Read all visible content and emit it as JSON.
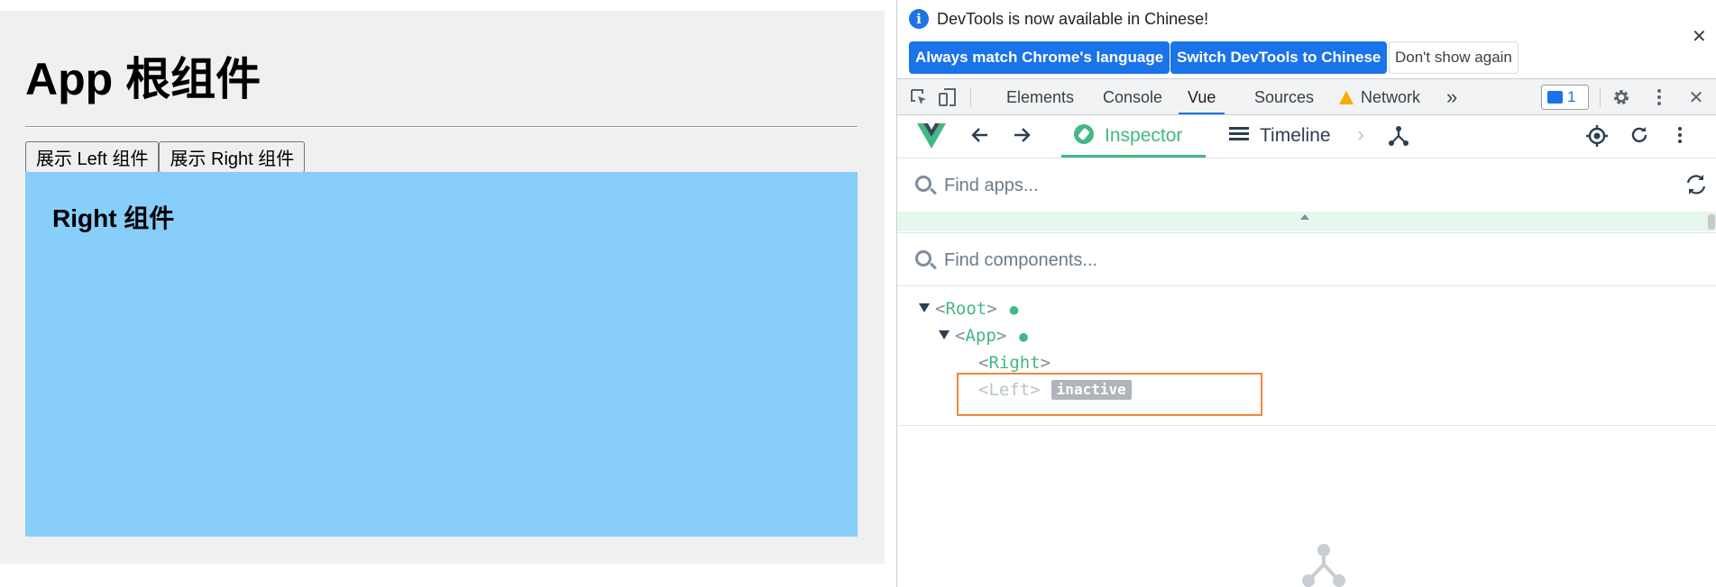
{
  "page": {
    "title": "App 根组件",
    "buttons": {
      "show_left": "展示 Left 组件",
      "show_right": "展示 Right 组件"
    },
    "right_component_title": "Right 组件",
    "colors": {
      "page_bg": "#f0f0f0",
      "right_box": "#87cefa"
    }
  },
  "devtools": {
    "infobar": {
      "message": "DevTools is now available in Chinese!",
      "buttons": {
        "match_language": "Always match Chrome's language",
        "switch_chinese": "Switch DevTools to Chinese",
        "dont_show": "Don't show again"
      },
      "close_icon": "✕"
    },
    "toolbar": {
      "tabs": [
        "Elements",
        "Console",
        "Vue",
        "Sources",
        "Network"
      ],
      "active_tab": "Vue",
      "more_tabs_icon": "»",
      "issues_count": "1",
      "close_icon": "✕"
    },
    "vue": {
      "tabs": {
        "inspector": "Inspector",
        "timeline": "Timeline"
      },
      "accent": "#42b883",
      "find_apps_placeholder": "Find apps...",
      "find_components_placeholder": "Find components...",
      "tree": {
        "root": {
          "name": "Root"
        },
        "app": {
          "name": "App"
        },
        "right": {
          "name": "Right"
        },
        "left": {
          "name": "Left",
          "badge": "inactive"
        }
      },
      "highlight_color": "#f0853c"
    }
  }
}
